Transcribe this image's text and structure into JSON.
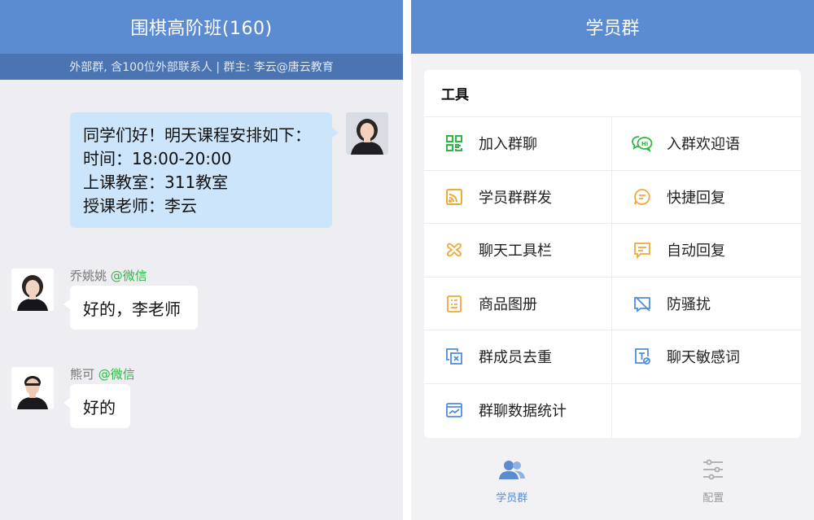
{
  "left": {
    "title": "围棋高阶班(160)",
    "subtitle": "外部群, 含100位外部联系人 | 群主: 李云@唐云教育",
    "messages": [
      {
        "lines": [
          "同学们好！明天课程安排如下：",
          "时间：18:00-20:00",
          "上课教室：311教室",
          "授课老师：李云"
        ]
      },
      {
        "sender": "乔姚姚",
        "tag": "@微信",
        "text": "好的，李老师"
      },
      {
        "sender": "熊可",
        "tag": "@微信",
        "text": "好的"
      }
    ]
  },
  "right": {
    "title": "学员群",
    "section_title": "工具",
    "tools": [
      {
        "label": "加入群聊",
        "icon": "qrcode-icon",
        "color": "#2db845"
      },
      {
        "label": "入群欢迎语",
        "icon": "welcome-chat-icon",
        "color": "#2db845"
      },
      {
        "label": "学员群群发",
        "icon": "broadcast-icon",
        "color": "#f1a83a"
      },
      {
        "label": "快捷回复",
        "icon": "quick-reply-icon",
        "color": "#f1a83a"
      },
      {
        "label": "聊天工具栏",
        "icon": "toolbar-icon",
        "color": "#f1a83a"
      },
      {
        "label": "自动回复",
        "icon": "auto-reply-icon",
        "color": "#f1a83a"
      },
      {
        "label": "商品图册",
        "icon": "catalog-icon",
        "color": "#f1a83a"
      },
      {
        "label": "防骚扰",
        "icon": "anti-harass-icon",
        "color": "#4f8ce0"
      },
      {
        "label": "群成员去重",
        "icon": "dedupe-icon",
        "color": "#4f8ce0"
      },
      {
        "label": "聊天敏感词",
        "icon": "sensitive-word-icon",
        "color": "#4f8ce0"
      },
      {
        "label": "群聊数据统计",
        "icon": "stats-icon",
        "color": "#4f8ce0"
      }
    ],
    "tabs": [
      {
        "label": "学员群",
        "icon": "group-icon",
        "active": true
      },
      {
        "label": "配置",
        "icon": "settings-sliders-icon",
        "active": false
      }
    ]
  },
  "colors": {
    "accent": "#5b8bd1",
    "bubble": "#cde5fb",
    "green": "#2db845",
    "orange": "#f1a83a",
    "blue": "#4f8ce0"
  }
}
